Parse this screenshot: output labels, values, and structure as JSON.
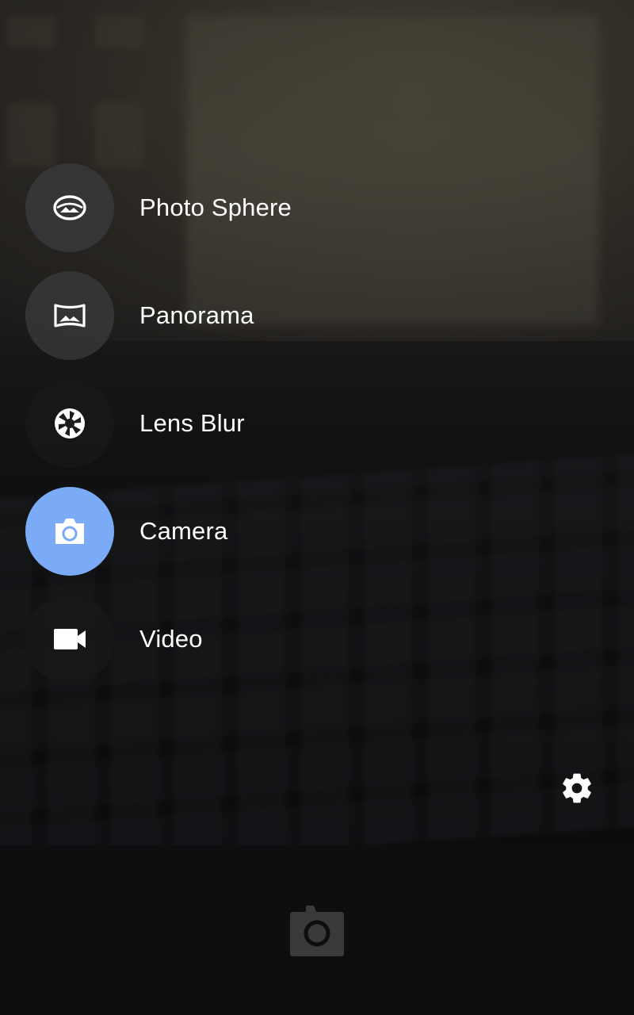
{
  "modes": [
    {
      "label": "Photo Sphere",
      "icon": "photo-sphere-icon",
      "active": false
    },
    {
      "label": "Panorama",
      "icon": "panorama-icon",
      "active": false
    },
    {
      "label": "Lens Blur",
      "icon": "lens-blur-icon",
      "active": false
    },
    {
      "label": "Camera",
      "icon": "camera-icon",
      "active": true
    },
    {
      "label": "Video",
      "icon": "video-icon",
      "active": false
    }
  ],
  "settings": {
    "icon": "gear-icon"
  },
  "shutter": {
    "icon": "camera-icon"
  },
  "colors": {
    "active_mode": "#7baaf7",
    "label_text": "#ffffff",
    "bottom_bar": "#0e0e10",
    "shutter_icon": "#3a3a3c"
  }
}
